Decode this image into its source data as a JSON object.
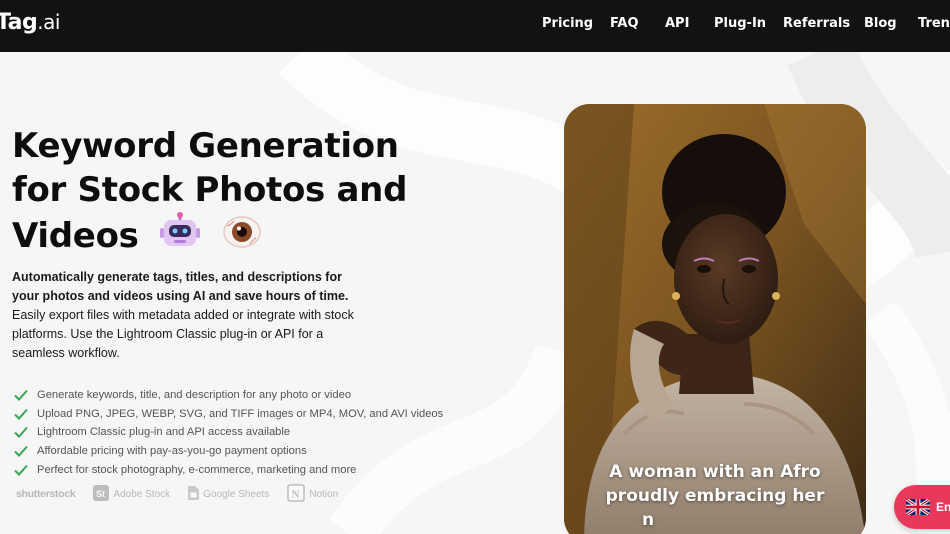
{
  "header": {
    "logo_main": "Tag",
    "logo_suffix": ".ai",
    "nav": [
      "Pricing",
      "FAQ",
      "API",
      "Plug-In",
      "Referrals",
      "Blog",
      "Trends"
    ]
  },
  "hero": {
    "title_line1": "Keyword Generation",
    "title_line2": "for Stock Photos and",
    "title_line3": "Videos",
    "lead_bold": "Automatically generate tags, titles, and descriptions for your photos and videos using AI and save hours of time.",
    "lead_rest": " Easily export files with metadata added or integrate with stock platforms. Use the Lightroom Classic plug-in or API for a seamless workflow.",
    "features": [
      "Generate keywords, title, and description for any photo or video",
      "Upload PNG, JPEG, WEBP, SVG, and TIFF images or MP4, MOV, and AVI videos",
      "Lightroom Classic plug-in and API access available",
      "Affordable pricing with pay-as-you-go payment options",
      "Perfect for stock photography, e-commerce, marketing and more"
    ],
    "platforms": [
      "shutterstock",
      "Adobe Stock",
      "Google Sheets",
      "Notion"
    ],
    "check_color": "#3aa655"
  },
  "demo": {
    "caption_line1": "A woman with an Afro",
    "caption_line2": "proudly embracing her",
    "caption_line3": "n"
  },
  "language": {
    "label": "En",
    "flag_icon": "uk-flag-icon",
    "color": "#e8385c"
  }
}
